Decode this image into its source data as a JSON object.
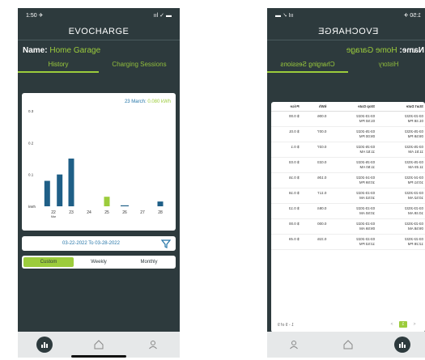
{
  "phone1": {
    "status": {
      "time": "1:50 ✈︎",
      "signal": "ııl ✓ ▬"
    },
    "app_title": "EVOCHARGE",
    "name_label": "Name:",
    "name_value": "Home Garage",
    "tabs": [
      "History",
      "Charging Sessions"
    ],
    "active_tab": 0,
    "chart": {
      "title_date": "23 March:",
      "title_value": "0.080 kWh"
    },
    "date_range": "03-22-2022  To  03-28-2022",
    "segments": [
      "Custom",
      "Weekly",
      "Monthly"
    ],
    "active_segment": 0,
    "nav": [
      "stats-icon",
      "home-icon",
      "user-icon"
    ]
  },
  "chart_data": {
    "type": "bar",
    "categories": [
      "22",
      "23",
      "24",
      "25",
      "26",
      "27",
      "28"
    ],
    "category_sub": [
      "Mar",
      "",
      "",
      "",
      "",
      "",
      ""
    ],
    "y_tick_labels": [
      "kWh",
      "0.1",
      "0.2",
      "0.3"
    ],
    "series": [
      {
        "values": [
          0.16,
          0.2
        ],
        "x_index": [
          0,
          1
        ]
      }
    ],
    "bars": [
      {
        "category": "22",
        "value": 0.08,
        "color": "#1f5f87"
      },
      {
        "category": "22",
        "value": 0.1,
        "color": "#1f5f87"
      },
      {
        "category": "23",
        "value": 0.15,
        "color": "#1f5f87"
      },
      {
        "category": "25",
        "value": 0.03,
        "color": "#9ccc3c"
      },
      {
        "category": "26",
        "value": 0.003,
        "color": "#1f5f87"
      },
      {
        "category": "28",
        "value": 0.015,
        "color": "#1f5f87"
      }
    ]
  },
  "phone2": {
    "app_title": "EVOCHARGE",
    "name_label": "Name:",
    "name_value": "Home Garage",
    "tabs": [
      "History",
      "Charging Sessions"
    ],
    "active_tab": 1,
    "table": {
      "headers": [
        "Start Date",
        "Stop Date",
        "kWh",
        "Price"
      ],
      "rows": [
        [
          "03-23-2022\n01:48 PM",
          "03-23-2022\n01:50 PM",
          "0.006",
          "$ 0.00"
        ],
        [
          "03-25-2022\n09:59 PM",
          "03-25-2022\n09:00 PM",
          "0.007",
          "$ 0.01"
        ],
        [
          "03-25-2022\n11:51 AM",
          "03-25-2022\n11:52 AM",
          "0.037",
          "$ 0.1"
        ],
        [
          "03-25-2022\n11:49 AM",
          "03-25-2022\n11:50 AM",
          "0.023",
          "$ 0.03"
        ],
        [
          "03-24-2022\n10:51 PM",
          "03-24-2022\n10:59 PM",
          "0.106",
          "$ 0.16"
        ],
        [
          "03-23-2022\n10:52 AM",
          "03-23-2022\n10:53 AM",
          "0.117",
          "$ 0.18"
        ],
        [
          "03-23-2022\n10:49 AM",
          "03-23-2022\n10:50 AM",
          "0.084",
          "$ 0.13"
        ],
        [
          "03-23-2022\n09:58 AM",
          "03-23-2022\n09:59 AM",
          "0.000",
          "$ 0.00"
        ],
        [
          "03-22-2022\n12:28 PM",
          "03-22-2022\n12:53 PM",
          "0.315",
          "$ 0.49"
        ]
      ]
    },
    "pager": {
      "prev": "<",
      "page": "1",
      "next": ">",
      "info": "1 - 9 of 9"
    }
  }
}
